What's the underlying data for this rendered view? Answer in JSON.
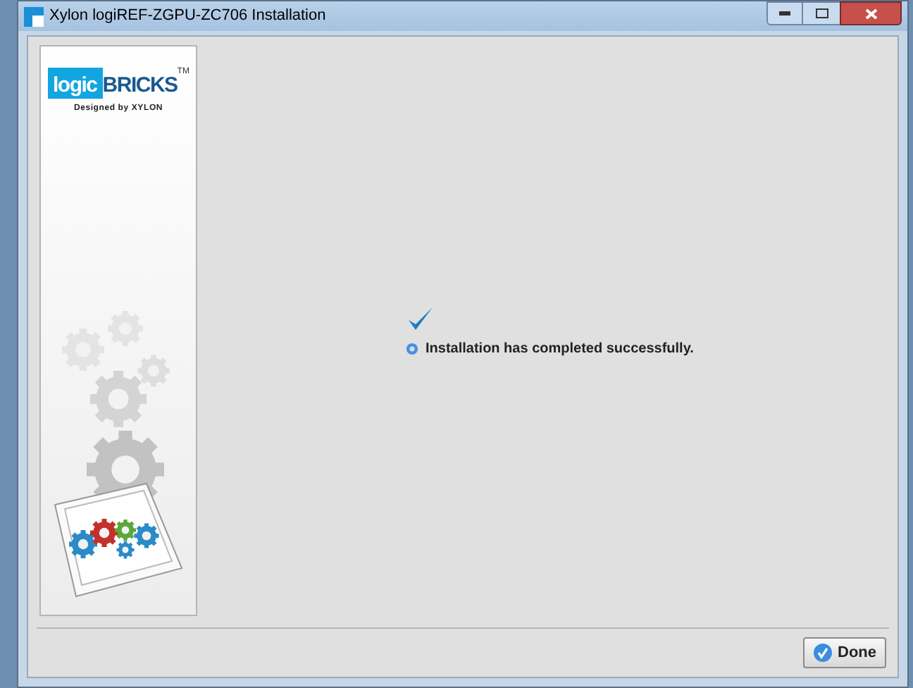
{
  "window": {
    "title": "Xylon logiREF-ZGPU-ZC706 Installation"
  },
  "logo": {
    "prefix": "logic",
    "name": "BRICKS",
    "mark": "TM",
    "tagline": "Designed by XYLON"
  },
  "status": {
    "message": "Installation has completed successfully."
  },
  "buttons": [
    {
      "label": "Done"
    }
  ]
}
